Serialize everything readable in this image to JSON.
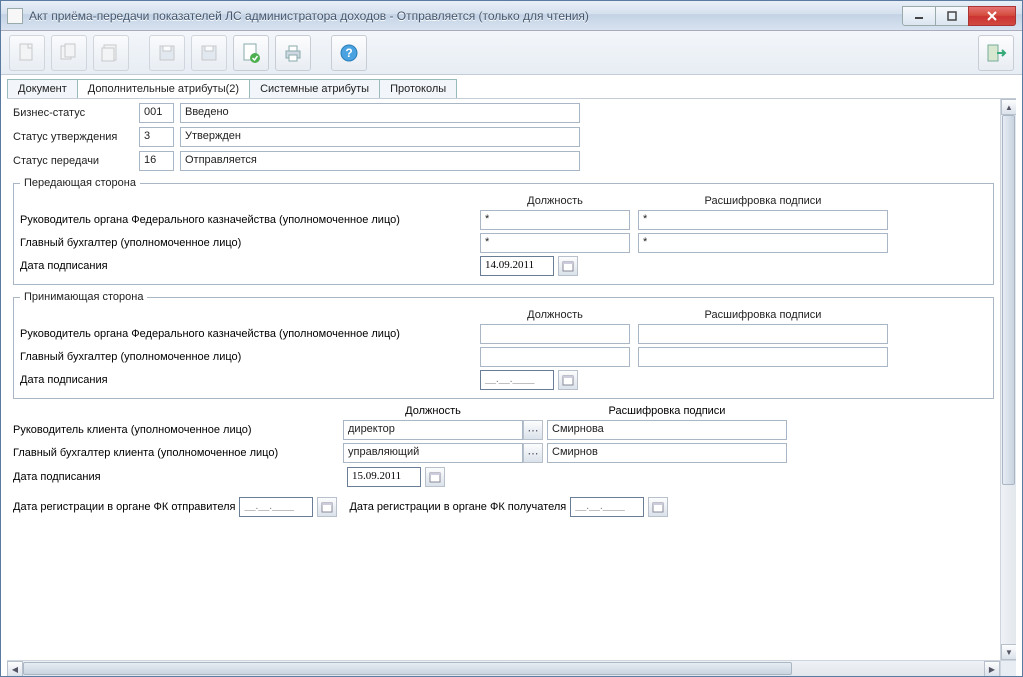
{
  "window": {
    "title": "Акт приёма-передачи показателей ЛС администратора доходов - Отправляется (только для чтения)"
  },
  "tabs": {
    "doc": "Документ",
    "extra": "Дополнительные атрибуты(2)",
    "system": "Системные атрибуты",
    "proto": "Протоколы"
  },
  "status": {
    "biz_label": "Бизнес-статус",
    "biz_code": "001",
    "biz_text": "Введено",
    "approve_label": "Статус утверждения",
    "approve_code": "3",
    "approve_text": "Утвержден",
    "transfer_label": "Статус передачи",
    "transfer_code": "16",
    "transfer_text": "Отправляется"
  },
  "headers": {
    "position": "Должность",
    "signature_decode": "Расшифровка подписи",
    "sign_date": "Дата подписания"
  },
  "sender": {
    "legend": "Передающая сторона",
    "head_label": "Руководитель органа Федерального казначейства (уполномоченное лицо)",
    "head_pos": "*",
    "head_sig": "*",
    "acc_label": "Главный бухгалтер (уполномоченное лицо)",
    "acc_pos": "*",
    "acc_sig": "*",
    "sign_date": "14.09.2011"
  },
  "receiver": {
    "legend": "Принимающая сторона",
    "head_label": "Руководитель органа Федерального казначейства (уполномоченное лицо)",
    "head_pos": "",
    "head_sig": "",
    "acc_label": "Главный бухгалтер (уполномоченное лицо)",
    "acc_pos": "",
    "acc_sig": "",
    "sign_date": "__.__.____"
  },
  "client": {
    "head_label": "Руководитель клиента (уполномоченное лицо)",
    "head_pos": "директор",
    "head_sig": "Смирнова",
    "acc_label": "Главный бухгалтер клиента (уполномоченное лицо)",
    "acc_pos": "управляющий",
    "acc_sig": "Смирнов",
    "sign_date_label": "Дата подписания",
    "sign_date": "15.09.2011"
  },
  "reg": {
    "sender_label": "Дата регистрации в органе ФК отправителя",
    "sender_date": "__.__.____",
    "receiver_label": "Дата регистрации в органе ФК получателя",
    "receiver_date": "__.__.____"
  }
}
